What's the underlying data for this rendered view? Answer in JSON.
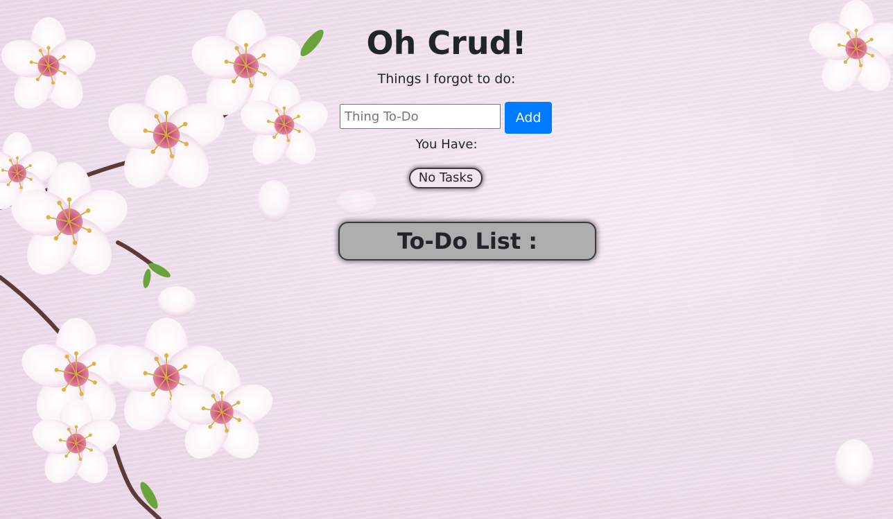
{
  "app": {
    "title": "Oh Crud!",
    "subtitle": "Things I forgot to do:"
  },
  "form": {
    "input_placeholder": "Thing To-Do",
    "input_value": "",
    "add_label": "Add"
  },
  "summary": {
    "label": "You Have:",
    "count_text": "No Tasks"
  },
  "list": {
    "header": "To-Do List :",
    "items": []
  },
  "colors": {
    "accent": "#007bff",
    "text": "#212529",
    "list_header_bg": "#aeaeae",
    "badge_bg": "#f3e6f0"
  },
  "background": {
    "description_icon": "cherry-blossom-background"
  }
}
